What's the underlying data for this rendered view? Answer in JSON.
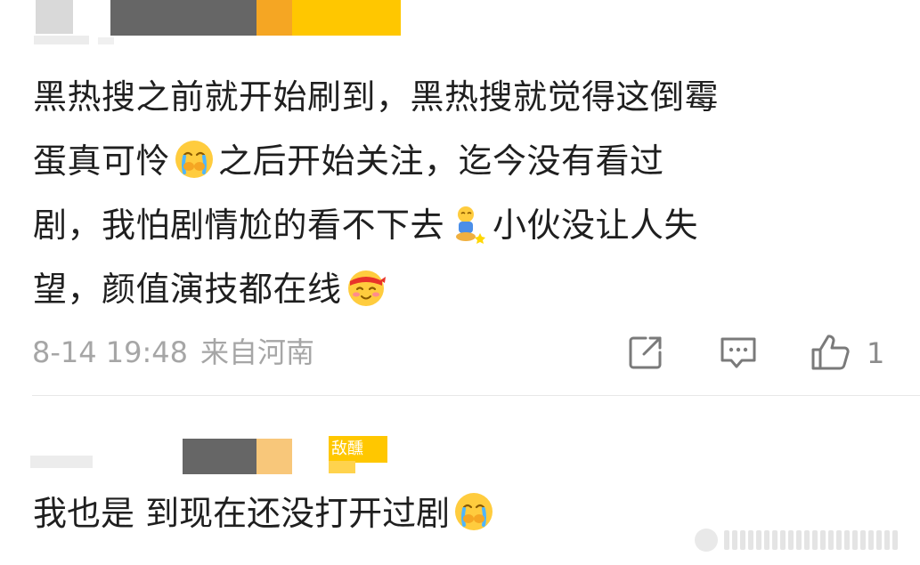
{
  "comment": {
    "lines": [
      [
        "黑热搜之前就开始刷到，黑热搜就觉得这倒霉"
      ],
      [
        "蛋真可怜",
        "之后开始关注，迄今没有看过"
      ],
      [
        "剧，我怕剧情尬的看不下去",
        "小伙没让人失"
      ],
      [
        "望，颜值演技都在线"
      ]
    ],
    "emoji_icons": [
      "crying-face-icon",
      "kneeling-person-icon",
      "headband-face-icon"
    ],
    "date": "8-14",
    "time": "19:48",
    "location": "来自河南",
    "like_count": "1",
    "actions": [
      "share-icon",
      "reply-icon",
      "like-icon"
    ]
  },
  "reply": {
    "badge_text": "敌醺",
    "text": "我也是 到现在还没打开过剧",
    "emoji_icon": "crying-face-icon"
  },
  "colors": {
    "text": "#1f1f1f",
    "meta": "#a6a6a6",
    "accent_yellow": "#ffc700",
    "accent_orange": "#f5a623"
  }
}
